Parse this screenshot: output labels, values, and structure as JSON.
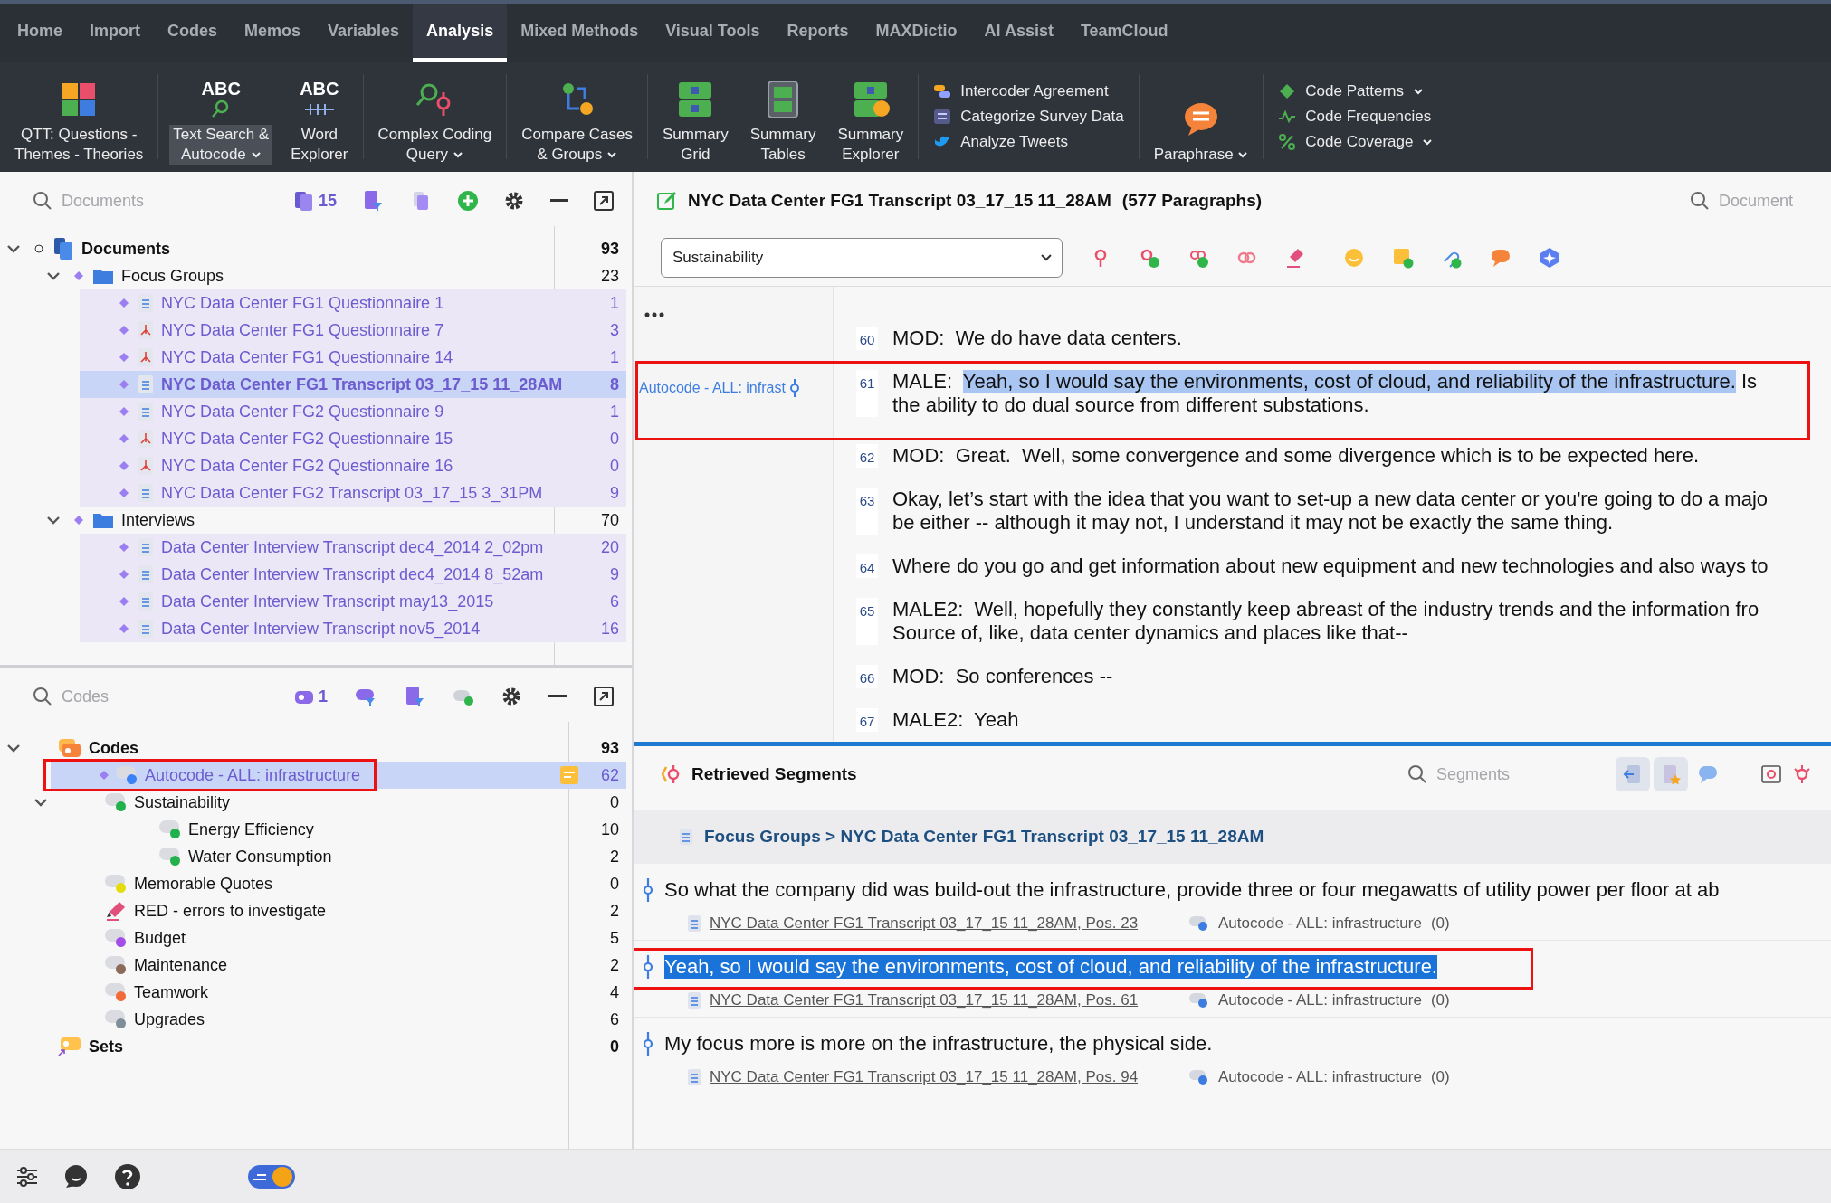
{
  "tabs": [
    {
      "label": "Home",
      "selected": false
    },
    {
      "label": "Import",
      "selected": false
    },
    {
      "label": "Codes",
      "selected": false
    },
    {
      "label": "Memos",
      "selected": false
    },
    {
      "label": "Variables",
      "selected": false
    },
    {
      "label": "Analysis",
      "selected": true
    },
    {
      "label": "Mixed Methods",
      "selected": false
    },
    {
      "label": "Visual Tools",
      "selected": false
    },
    {
      "label": "Reports",
      "selected": false
    },
    {
      "label": "MAXDictio",
      "selected": false
    },
    {
      "label": "AI Assist",
      "selected": false
    },
    {
      "label": "TeamCloud",
      "selected": false
    }
  ],
  "ribbon": [
    {
      "kind": "big",
      "label": "QTT: Questions -\nThemes - Theories",
      "dropdown": false,
      "selected": false
    },
    {
      "kind": "big",
      "icon_text": "ABC",
      "label": "Text Search &\nAutocode",
      "dropdown": true,
      "selected": true
    },
    {
      "kind": "big",
      "icon_text": "ABC",
      "label": "Word\nExplorer",
      "dropdown": false,
      "selected": false
    },
    {
      "kind": "big",
      "label": "Complex Coding\nQuery",
      "dropdown": true,
      "selected": false
    },
    {
      "kind": "big",
      "label": "Compare Cases\n& Groups",
      "dropdown": true,
      "selected": false
    },
    {
      "kind": "big",
      "label": "Summary\nGrid",
      "dropdown": false,
      "selected": false
    },
    {
      "kind": "big",
      "label": "Summary\nTables",
      "dropdown": false,
      "selected": false
    },
    {
      "kind": "big",
      "label": "Summary\nExplorer",
      "dropdown": false,
      "selected": false
    },
    {
      "kind": "list",
      "items": [
        {
          "label": "Intercoder Agreement",
          "dropdown": false
        },
        {
          "label": "Categorize Survey Data",
          "dropdown": false
        },
        {
          "label": "Analyze Tweets",
          "dropdown": false
        }
      ]
    },
    {
      "kind": "big",
      "label": "Paraphrase",
      "dropdown": true,
      "selected": false
    },
    {
      "kind": "list",
      "items": [
        {
          "label": "Code Patterns",
          "dropdown": true
        },
        {
          "label": "Code Frequencies",
          "dropdown": false
        },
        {
          "label": "Code Coverage",
          "dropdown": true
        }
      ]
    }
  ],
  "documents": {
    "placeholder": "Documents",
    "count": "15",
    "tree": [
      {
        "label": "Documents",
        "count": "93",
        "kind": "root",
        "expanded": true,
        "selected": false,
        "children": [
          {
            "label": "Focus Groups",
            "count": "23",
            "kind": "folder",
            "expanded": true,
            "selected": false,
            "children": [
              {
                "label": "NYC Data Center FG1 Questionnaire 1",
                "count": "1",
                "kind": "text",
                "selected": false
              },
              {
                "label": "NYC Data Center FG1 Questionnaire 7",
                "count": "3",
                "kind": "pdf",
                "selected": false
              },
              {
                "label": "NYC Data Center FG1 Questionnaire 14",
                "count": "1",
                "kind": "pdf",
                "selected": false
              },
              {
                "label": "NYC Data Center FG1 Transcript 03_17_15 11_28AM",
                "count": "8",
                "kind": "text",
                "selected": true
              },
              {
                "label": "NYC Data Center FG2 Questionnaire 9",
                "count": "1",
                "kind": "text",
                "selected": false
              },
              {
                "label": "NYC Data Center FG2 Questionnaire 15",
                "count": "0",
                "kind": "pdf",
                "selected": false
              },
              {
                "label": "NYC Data Center FG2 Questionnaire 16",
                "count": "0",
                "kind": "pdf",
                "selected": false
              },
              {
                "label": "NYC Data Center FG2 Transcript 03_17_15 3_31PM",
                "count": "9",
                "kind": "text",
                "selected": false
              }
            ]
          },
          {
            "label": "Interviews",
            "count": "70",
            "kind": "folder",
            "expanded": true,
            "selected": false,
            "children": [
              {
                "label": "Data Center Interview Transcript dec4_2014 2_02pm",
                "count": "20",
                "kind": "text",
                "selected": false
              },
              {
                "label": "Data Center Interview Transcript dec4_2014 8_52am",
                "count": "9",
                "kind": "text",
                "selected": false
              },
              {
                "label": "Data Center Interview Transcript may13_2015",
                "count": "6",
                "kind": "text",
                "selected": false
              },
              {
                "label": "Data Center Interview Transcript nov5_2014",
                "count": "16",
                "kind": "text",
                "selected": false
              }
            ]
          }
        ]
      }
    ]
  },
  "codes": {
    "placeholder": "Codes",
    "count": "1",
    "tree": [
      {
        "label": "Codes",
        "count": "93",
        "kind": "root",
        "expanded": true,
        "selected": false,
        "memo": false,
        "annotated": false,
        "children": [
          {
            "label": "Autocode - ALL: infrastructure",
            "count": "62",
            "kind": "code",
            "color": "#3b82f6",
            "selected": true,
            "memo": true,
            "annotated": true
          },
          {
            "label": "Sustainability",
            "count": "0",
            "kind": "code",
            "color": "#22b14c",
            "selected": false,
            "memo": false,
            "annotated": false,
            "expanded": true,
            "children": [
              {
                "label": "Energy Efficiency",
                "count": "10",
                "kind": "code",
                "color": "#22b14c",
                "selected": false,
                "memo": false,
                "annotated": false
              },
              {
                "label": "Water Consumption",
                "count": "2",
                "kind": "code",
                "color": "#22b14c",
                "selected": false,
                "memo": false,
                "annotated": false
              }
            ]
          },
          {
            "label": "Memorable Quotes",
            "count": "0",
            "kind": "code",
            "color": "#e5dc10",
            "selected": false,
            "memo": false,
            "annotated": false
          },
          {
            "label": "RED - errors to investigate",
            "count": "2",
            "kind": "marker",
            "selected": false,
            "memo": false,
            "annotated": false
          },
          {
            "label": "Budget",
            "count": "5",
            "kind": "code",
            "color": "#a44ee8",
            "selected": false,
            "memo": false,
            "annotated": false
          },
          {
            "label": "Maintenance",
            "count": "2",
            "kind": "code",
            "color": "#8b6a5a",
            "selected": false,
            "memo": false,
            "annotated": false
          },
          {
            "label": "Teamwork",
            "count": "4",
            "kind": "code",
            "color": "#f26a3a",
            "selected": false,
            "memo": false,
            "annotated": false
          },
          {
            "label": "Upgrades",
            "count": "6",
            "kind": "code",
            "color": "#7f8f9a",
            "selected": false,
            "memo": false,
            "annotated": false
          }
        ]
      },
      {
        "label": "Sets",
        "count": "0",
        "kind": "sets",
        "selected": false,
        "memo": false,
        "annotated": false
      }
    ]
  },
  "document": {
    "title": "NYC Data Center FG1 Transcript 03_17_15 11_28AM",
    "paragraphs_count": "(577 Paragraphs)",
    "search_placeholder": "Document",
    "code_select": "Sustainability",
    "paragraphs": [
      {
        "number": "60",
        "lines": [
          "MOD:  We do have data centers."
        ],
        "annotated": false
      },
      {
        "number": "61",
        "margin_code": "Autocode - ALL: infrast",
        "coded": {
          "before": "MALE:  ",
          "text": "Yeah, so I would say the environments, cost of cloud, and reliability of the infrastructure.",
          "after": " Is"
        },
        "lines": [
          "the ability to do dual source from different substations."
        ],
        "annotated": true
      },
      {
        "number": "62",
        "lines": [
          "MOD:  Great.  Well, some convergence and some divergence which is to be expected here."
        ],
        "annotated": false
      },
      {
        "number": "63",
        "lines": [
          "Okay, let’s start with the idea that you want to set-up a new data center or you're going to do a majo",
          "be either -- although it may not, I understand it may not be exactly the same thing."
        ],
        "annotated": false
      },
      {
        "number": "64",
        "lines": [
          "Where do you go and get information about new equipment and new technologies and also ways to"
        ],
        "annotated": false
      },
      {
        "number": "65",
        "lines": [
          "MALE2:  Well, hopefully they constantly keep abreast of the industry trends and the information fro",
          "Source of, like, data center dynamics and places like that--"
        ],
        "annotated": false
      },
      {
        "number": "66",
        "lines": [
          "MOD:  So conferences --"
        ],
        "annotated": false
      },
      {
        "number": "67",
        "lines": [
          "MALE2:  Yeah"
        ],
        "annotated": false
      }
    ]
  },
  "segments": {
    "title": "Retrieved Segments",
    "search_placeholder": "Segments",
    "breadcrumb": "Focus Groups > NYC Data Center FG1 Transcript 03_17_15 11_28AM",
    "items": [
      {
        "text": "So what the company did was build-out the infrastructure, provide three or four megawatts of utility power per floor at ab",
        "source": "NYC Data Center FG1 Transcript 03_17_15 11_28AM, Pos. 23",
        "code": "Autocode - ALL: infrastructure",
        "count": "(0)",
        "selected": false,
        "annotated": false
      },
      {
        "text": "Yeah, so I would say the environments, cost of cloud, and reliability of the infrastructure.",
        "source": "NYC Data Center FG1 Transcript 03_17_15 11_28AM, Pos. 61",
        "code": "Autocode - ALL: infrastructure",
        "count": "(0)",
        "selected": true,
        "annotated": true
      },
      {
        "text": "My focus more is more on the infrastructure, the physical side.",
        "source": "NYC Data Center FG1 Transcript 03_17_15 11_28AM, Pos. 94",
        "code": "Autocode - ALL: infrastructure",
        "count": "(0)",
        "selected": false,
        "annotated": false
      }
    ]
  }
}
